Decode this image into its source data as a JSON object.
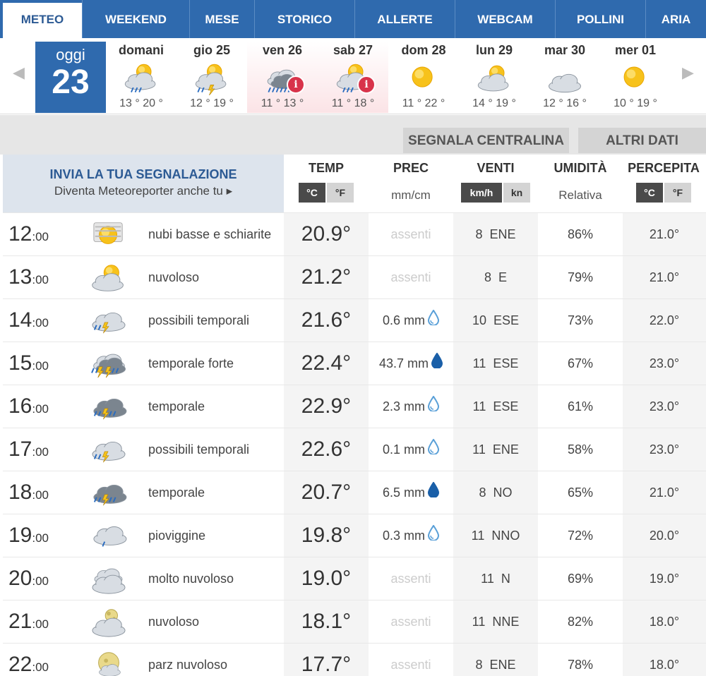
{
  "nav": {
    "tabs": [
      "METEO",
      "WEEKEND",
      "MESE",
      "STORICO",
      "ALLERTE",
      "WEBCAM",
      "POLLINI",
      "ARIA"
    ],
    "active": "METEO"
  },
  "days": {
    "today_label": "oggi",
    "today_number": "23",
    "items": [
      {
        "name": "domani",
        "temps": "13 ° 20 °",
        "icon": "sun-cloud-rain-icon",
        "alert": false
      },
      {
        "name": "gio 25",
        "temps": "12 ° 19 °",
        "icon": "sun-cloud-storm-icon",
        "alert": false
      },
      {
        "name": "ven 26",
        "temps": "11 ° 13 °",
        "icon": "cloud-heavy-rain-icon",
        "alert": true
      },
      {
        "name": "sab 27",
        "temps": "11 ° 18 °",
        "icon": "sun-cloud-rain-icon",
        "alert": true
      },
      {
        "name": "dom 28",
        "temps": "11 ° 22 °",
        "icon": "sun-icon",
        "alert": false
      },
      {
        "name": "lun 29",
        "temps": "14 ° 19 °",
        "icon": "sun-cloud-icon",
        "alert": false
      },
      {
        "name": "mar 30",
        "temps": "12 ° 16 °",
        "icon": "cloud-icon",
        "alert": false
      },
      {
        "name": "mer 01",
        "temps": "10 ° 19 °",
        "icon": "sun-icon",
        "alert": false
      }
    ],
    "alert_symbol": "i"
  },
  "band": {
    "report_station": "SEGNALA CENTRALINA",
    "more_data": "ALTRI DATI"
  },
  "header": {
    "report_title": "INVIA LA TUA SEGNALAZIONE",
    "report_subtitle": "Diventa Meteoreporter anche tu",
    "report_arrow": "▸",
    "temp": "TEMP",
    "prec": "PREC",
    "prec_unit": "mm/cm",
    "wind": "VENTI",
    "hum": "UMIDITÀ",
    "hum_unit": "Relativa",
    "perc": "PERCEPITA",
    "celsius": "°C",
    "fahrenheit": "°F",
    "kmh": "km/h",
    "kn": "kn"
  },
  "colors": {
    "accent": "#2f6aae",
    "drop_light": "#5aa0d8",
    "drop_dark": "#1a5fa8",
    "alert": "#d8334a"
  },
  "rows": [
    {
      "hour": "12",
      "min": ":00",
      "icon": "fog-sun-icon",
      "desc": "nubi basse e schiarite",
      "temp": "20.9°",
      "prec": "assenti",
      "drop": "",
      "wind": "8  ENE",
      "hum": "86%",
      "perc": "21.0°"
    },
    {
      "hour": "13",
      "min": ":00",
      "icon": "sun-cloud-icon",
      "desc": "nuvoloso",
      "temp": "21.2°",
      "prec": "assenti",
      "drop": "",
      "wind": "8  E",
      "hum": "79%",
      "perc": "21.0°"
    },
    {
      "hour": "14",
      "min": ":00",
      "icon": "cloud-lightning-icon",
      "desc": "possibili temporali",
      "temp": "21.6°",
      "prec": "0.6 mm",
      "drop": "light",
      "wind": "10  ESE",
      "hum": "73%",
      "perc": "22.0°"
    },
    {
      "hour": "15",
      "min": ":00",
      "icon": "storm-heavy-icon",
      "desc": "temporale forte",
      "temp": "22.4°",
      "prec": "43.7 mm",
      "drop": "dark",
      "wind": "11  ESE",
      "hum": "67%",
      "perc": "23.0°"
    },
    {
      "hour": "16",
      "min": ":00",
      "icon": "storm-icon",
      "desc": "temporale",
      "temp": "22.9°",
      "prec": "2.3 mm",
      "drop": "light",
      "wind": "11  ESE",
      "hum": "61%",
      "perc": "23.0°"
    },
    {
      "hour": "17",
      "min": ":00",
      "icon": "cloud-lightning-icon",
      "desc": "possibili temporali",
      "temp": "22.6°",
      "prec": "0.1 mm",
      "drop": "light",
      "wind": "11  ENE",
      "hum": "58%",
      "perc": "23.0°"
    },
    {
      "hour": "18",
      "min": ":00",
      "icon": "storm-icon",
      "desc": "temporale",
      "temp": "20.7°",
      "prec": "6.5 mm",
      "drop": "dark",
      "wind": "8  NO",
      "hum": "65%",
      "perc": "21.0°"
    },
    {
      "hour": "19",
      "min": ":00",
      "icon": "drizzle-icon",
      "desc": "pioviggine",
      "temp": "19.8°",
      "prec": "0.3 mm",
      "drop": "light",
      "wind": "11  NNO",
      "hum": "72%",
      "perc": "20.0°"
    },
    {
      "hour": "20",
      "min": ":00",
      "icon": "overcast-icon",
      "desc": "molto nuvoloso",
      "temp": "19.0°",
      "prec": "assenti",
      "drop": "",
      "wind": "11  N",
      "hum": "69%",
      "perc": "19.0°"
    },
    {
      "hour": "21",
      "min": ":00",
      "icon": "moon-cloud-icon",
      "desc": "nuvoloso",
      "temp": "18.1°",
      "prec": "assenti",
      "drop": "",
      "wind": "11  NNE",
      "hum": "82%",
      "perc": "18.0°"
    },
    {
      "hour": "22",
      "min": ":00",
      "icon": "moon-partly-cloudy-icon",
      "desc": "parz nuvoloso",
      "temp": "17.7°",
      "prec": "assenti",
      "drop": "",
      "wind": "8  ENE",
      "hum": "78%",
      "perc": "18.0°"
    }
  ]
}
